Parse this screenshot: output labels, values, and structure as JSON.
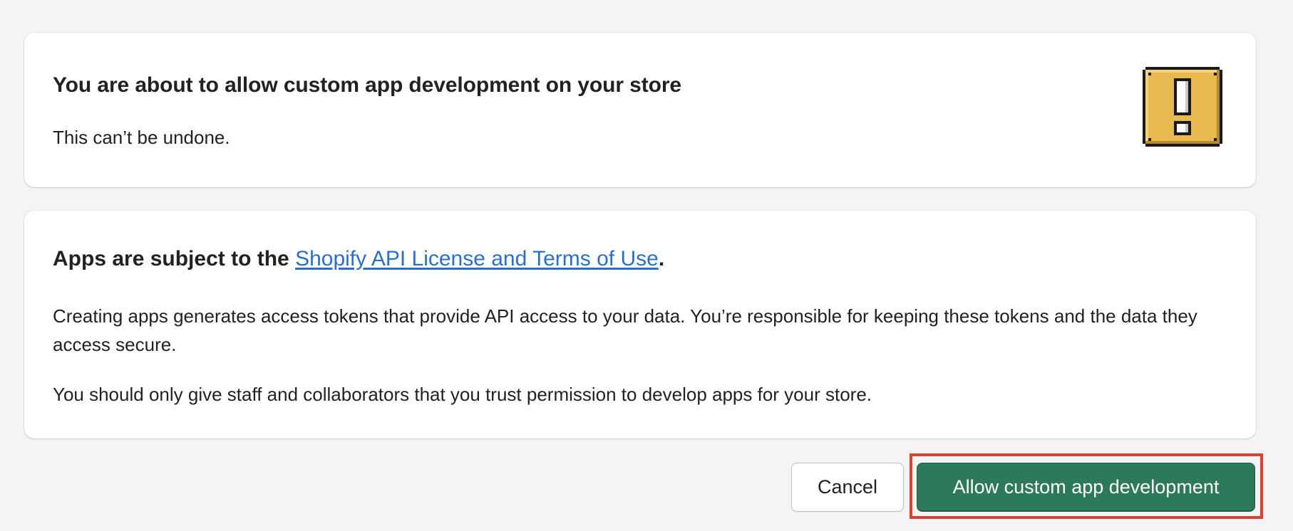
{
  "warning_card": {
    "title": "You are about to allow custom app development on your store",
    "subtitle": "This can’t be undone.",
    "icon": "exclamation-warning-icon"
  },
  "terms_card": {
    "title_prefix": "Apps are subject to the ",
    "link_text": "Shopify API License and Terms of Use",
    "title_suffix": ".",
    "paragraph_1": "Creating apps generates access tokens that provide API access to your data. You’re responsible for keeping these tokens and the data they access secure.",
    "paragraph_2": "You should only give staff and collaborators that you trust permission to develop apps for your store."
  },
  "actions": {
    "cancel_label": "Cancel",
    "confirm_label": "Allow custom app development"
  },
  "colors": {
    "primary": "#2d7a5a",
    "link": "#2c6ecb",
    "highlight": "#e0402f",
    "warning_icon": "#e8b94e"
  }
}
